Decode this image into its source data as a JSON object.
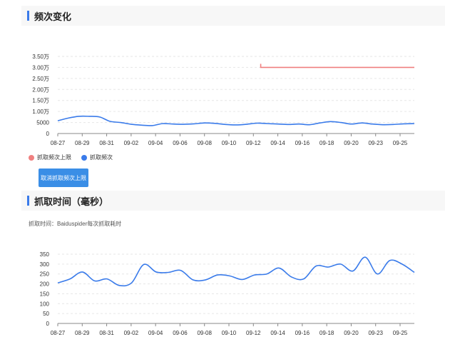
{
  "sections": {
    "frequency": {
      "title": "频次变化"
    },
    "crawl_time": {
      "title": "抓取时间（毫秒）",
      "description": "抓取时间：Baiduspider每次抓取耗时"
    }
  },
  "legend": {
    "limit": {
      "label": "抓取频次上限",
      "color": "#f08080"
    },
    "freq": {
      "label": "抓取频次",
      "color": "#3a7bea"
    }
  },
  "cancel_button": {
    "label": "取消抓取频次上限"
  },
  "chart_data": [
    {
      "type": "line",
      "title": "",
      "x_tick_labels": [
        "08-27",
        "08-29",
        "08-31",
        "09-02",
        "09-04",
        "09-06",
        "09-08",
        "09-10",
        "09-12",
        "09-14",
        "09-16",
        "09-18",
        "09-20",
        "09-23",
        "09-25"
      ],
      "y_tick_labels": [
        "0",
        "5000",
        "1.00万",
        "1.50万",
        "2.00万",
        "2.50万",
        "3.00万",
        "3.50万"
      ],
      "ylim": [
        0,
        35000
      ],
      "grid": true,
      "legend_position": "bottom-left",
      "series": [
        {
          "name": "抓取频次上限",
          "color": "#f08080",
          "x_index_start": 8.3,
          "values": [
            30000,
            30000
          ]
        },
        {
          "name": "抓取频次",
          "color": "#3a7bea",
          "values": [
            5800,
            7000,
            7800,
            7800,
            7500,
            5500,
            5000,
            4200,
            3800,
            3600,
            4500,
            4300,
            4200,
            4400,
            4800,
            4600,
            4100,
            3900,
            4200,
            4700,
            4500,
            4300,
            4100,
            4300,
            4000,
            4800,
            5400,
            5000,
            4300,
            4800,
            4300,
            4000,
            4100,
            4400,
            4500
          ]
        }
      ]
    },
    {
      "type": "line",
      "title": "",
      "x_tick_labels": [
        "08-27",
        "08-29",
        "08-31",
        "09-02",
        "09-04",
        "09-06",
        "09-08",
        "09-10",
        "09-12",
        "09-14",
        "09-16",
        "09-18",
        "09-20",
        "09-23",
        "09-25"
      ],
      "y_tick_labels": [
        "0",
        "50",
        "100",
        "150",
        "200",
        "250",
        "300",
        "350"
      ],
      "ylim": [
        0,
        350
      ],
      "grid": true,
      "series": [
        {
          "name": "",
          "color": "#3a7bea",
          "values": [
            205,
            225,
            260,
            215,
            225,
            192,
            205,
            298,
            260,
            258,
            268,
            220,
            220,
            245,
            240,
            222,
            245,
            250,
            280,
            235,
            225,
            290,
            285,
            300,
            265,
            335,
            250,
            318,
            300,
            258
          ]
        }
      ]
    }
  ]
}
